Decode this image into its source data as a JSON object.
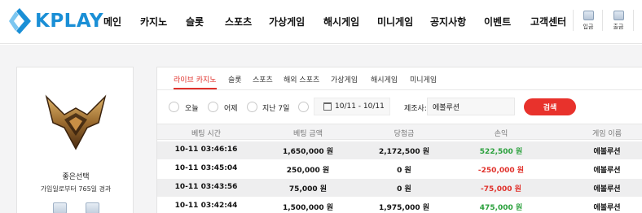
{
  "brand": {
    "name": "KPLAY",
    "accent": "#1a8fd6",
    "red": "#e0312b",
    "green": "#2aa03c"
  },
  "nav": {
    "items": [
      "메인",
      "카지노",
      "슬롯",
      "스포츠",
      "가상게임",
      "해시게임",
      "미니게임",
      "공지사항",
      "이벤트",
      "고객센터"
    ],
    "deposit_label": "입금",
    "withdraw_label": "출금"
  },
  "profile": {
    "nickname": "좋은선택",
    "joined_text": "가입일로부터 765일 경과"
  },
  "tabs": [
    "라이브 카지노",
    "슬롯",
    "스포츠",
    "해외 스포츠",
    "가상게임",
    "해시게임",
    "미니게임"
  ],
  "active_tab": "라이브 카지노",
  "filters": {
    "today": "오늘",
    "yesterday": "어제",
    "last7": "지난 7일",
    "date_range": "10/11 - 10/11",
    "maker_label": "제조사:",
    "maker_value": "에볼루션",
    "search_label": "검색"
  },
  "table": {
    "headers": [
      "베팅 시간",
      "베팅 금액",
      "당첨금",
      "손익",
      "게임 이름"
    ],
    "rows": [
      {
        "time": "10-11 03:46:16",
        "bet": "1,650,000 원",
        "win": "2,172,500 원",
        "profit": "522,500 원",
        "profit_sign": "pos",
        "game": "에볼루션"
      },
      {
        "time": "10-11 03:45:04",
        "bet": "250,000 원",
        "win": "0 원",
        "profit": "-250,000 원",
        "profit_sign": "neg",
        "game": "에볼루션"
      },
      {
        "time": "10-11 03:43:56",
        "bet": "75,000 원",
        "win": "0 원",
        "profit": "-75,000 원",
        "profit_sign": "neg",
        "game": "에볼루션"
      },
      {
        "time": "10-11 03:42:44",
        "bet": "1,500,000 원",
        "win": "1,975,000 원",
        "profit": "475,000 원",
        "profit_sign": "pos",
        "game": "에볼루션"
      }
    ]
  }
}
